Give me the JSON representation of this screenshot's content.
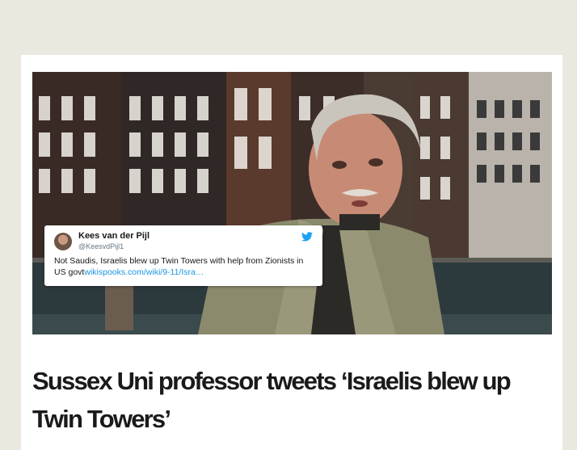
{
  "article": {
    "headline": "Sussex Uni professor tweets ‘Israelis blew up Twin Towers’"
  },
  "tweet": {
    "name": "Kees van der Pijl",
    "handle": "@KeesvdPijl1",
    "text": "Not Saudis, Israelis blew up Twin Towers  with help from Zionists in US govt",
    "link_text": "wikispooks.com/wiki/9-11/Isra…",
    "icon": "twitter-bird-icon"
  },
  "colors": {
    "page_background": "#ebe8df",
    "card_background": "#ffffff",
    "headline": "#1a1a1a",
    "twitter_blue": "#1b95e0"
  }
}
